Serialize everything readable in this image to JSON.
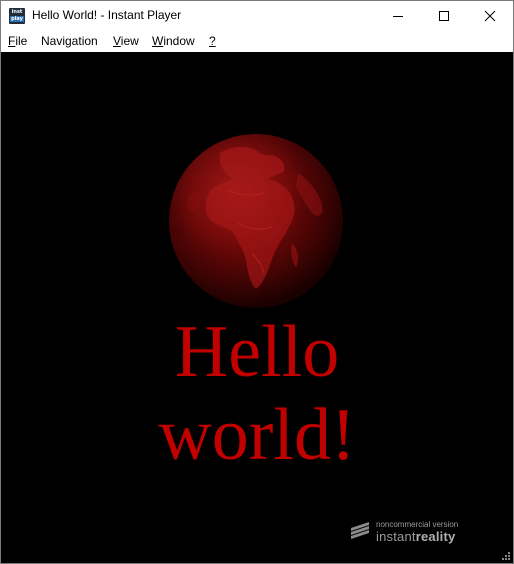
{
  "window": {
    "title": "Hello World! - Instant Player",
    "icon": "instant-player-app-icon",
    "icon_text_top": "inst",
    "icon_text_bottom": "play"
  },
  "controls": {
    "minimize": "minimize-icon",
    "maximize": "maximize-icon",
    "close": "close-icon"
  },
  "menu": [
    {
      "mnemonic": "F",
      "rest": "ile"
    },
    {
      "mnemonic": "",
      "rest": "Navigation"
    },
    {
      "mnemonic": "V",
      "rest": "iew"
    },
    {
      "mnemonic": "W",
      "rest": "indow"
    },
    {
      "mnemonic": "?",
      "rest": ""
    }
  ],
  "scene": {
    "background": "#000000",
    "globe_color": "#8b0000",
    "text_color": "#c10000",
    "text_line1": "Hello",
    "text_line2": "world!"
  },
  "watermark": {
    "line1": "noncommercial version",
    "line2_light": "instant",
    "line2_bold": "reality"
  }
}
